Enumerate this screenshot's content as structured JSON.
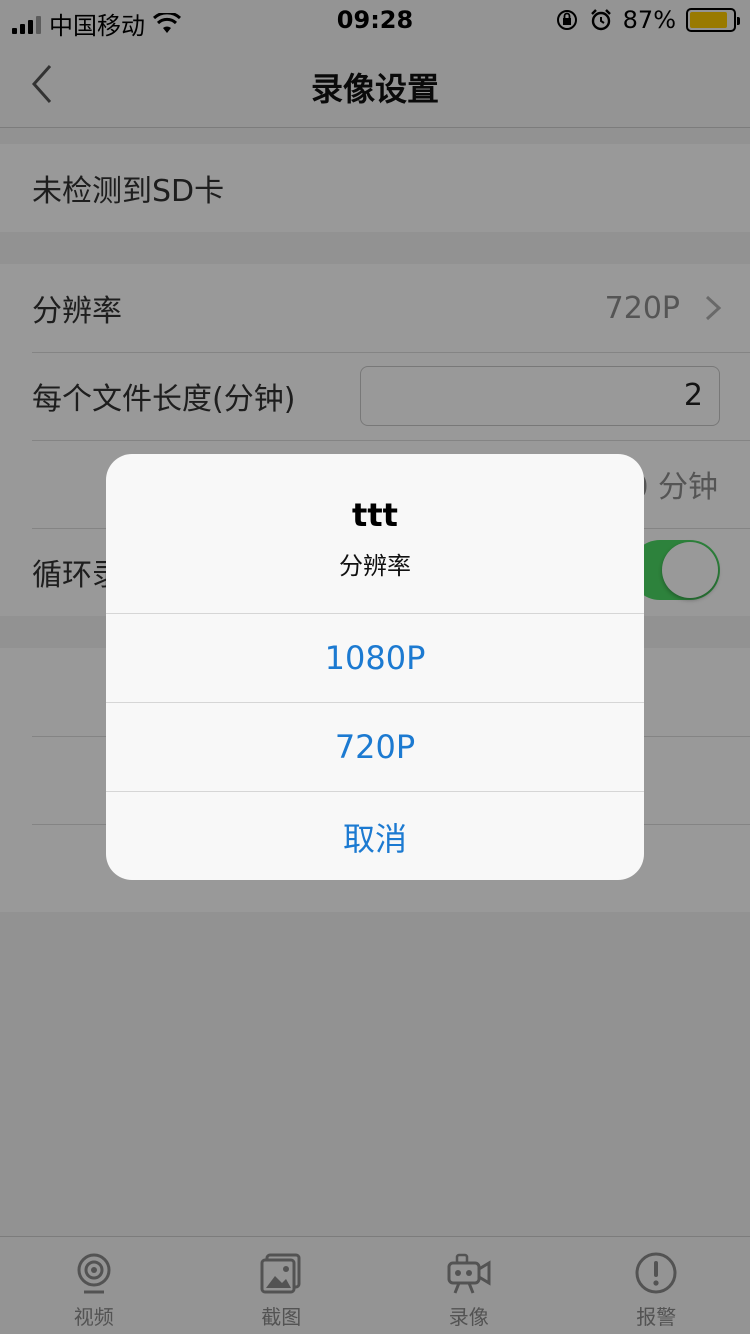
{
  "status_bar": {
    "carrier": "中国移动",
    "time": "09:28",
    "battery": "87%",
    "battery_level": 0.87
  },
  "nav": {
    "title": "录像设置"
  },
  "sections": {
    "sd": {
      "label": "未检测到SD卡"
    },
    "resolution": {
      "label": "分辨率",
      "value": "720P"
    },
    "file_length": {
      "label": "每个文件长度(分钟)",
      "value": "2"
    },
    "row3": {
      "tail": "0 分钟"
    },
    "loop": {
      "label": "循环录"
    }
  },
  "tabs": [
    {
      "label": "视频",
      "icon": "camera-icon"
    },
    {
      "label": "截图",
      "icon": "gallery-icon"
    },
    {
      "label": "录像",
      "icon": "video-camera-icon"
    },
    {
      "label": "报警",
      "icon": "alert-icon"
    }
  ],
  "action_sheet": {
    "title": "ttt",
    "message": "分辨率",
    "options": [
      "1080P",
      "720P"
    ],
    "cancel": "取消"
  },
  "colors": {
    "accent": "#1c7ad1",
    "toggle_on": "#4cd964",
    "battery": "#ffcc00"
  }
}
